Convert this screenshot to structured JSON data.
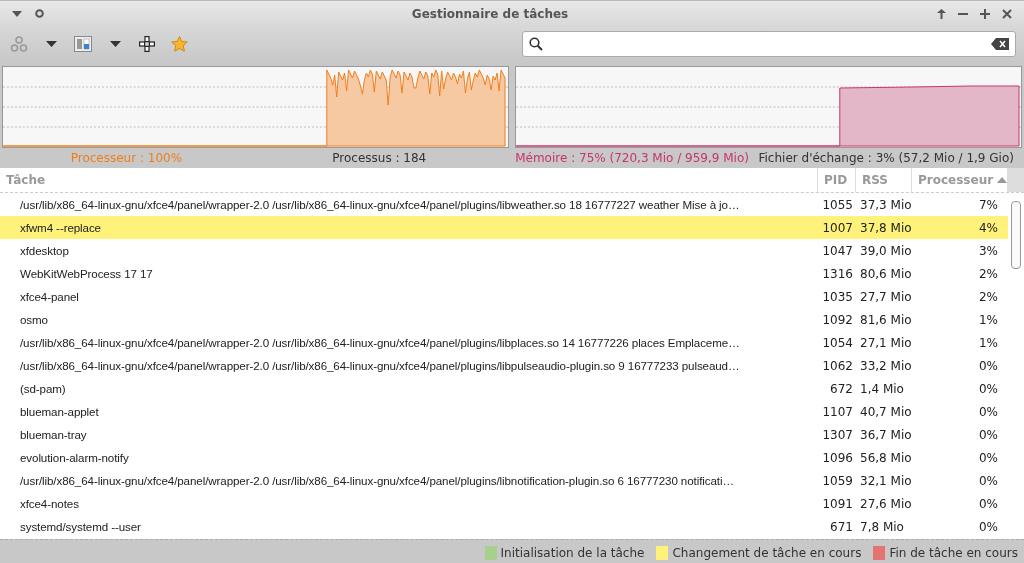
{
  "window": {
    "title": "Gestionnaire de tâches"
  },
  "stats": [
    {
      "kind": "cpu",
      "text": "Processeur : 100%"
    },
    {
      "kind": "plain",
      "text": "Processus : 184"
    },
    {
      "kind": "memory",
      "text": "Mémoire : 75% (720,3 Mio / 959,9 Mio)"
    },
    {
      "kind": "plain",
      "text": "Fichier d'échange : 3% (57,2 Mio / 1,9 Gio)"
    }
  ],
  "table": {
    "columns": [
      {
        "label": "Tâche",
        "sorted": false
      },
      {
        "label": "PID",
        "sorted": false
      },
      {
        "label": "RSS",
        "sorted": false
      },
      {
        "label": "Processeur",
        "sorted": true
      }
    ],
    "rows": [
      {
        "task": "/usr/lib/x86_64-linux-gnu/xfce4/panel/wrapper-2.0 /usr/lib/x86_64-linux-gnu/xfce4/panel/plugins/libweather.so 18 16777227 weather Mise à jo…",
        "pid": "1055",
        "rss": "37,3 Mio",
        "cpu": "7%",
        "changing": false
      },
      {
        "task": "xfwm4 --replace",
        "pid": "1007",
        "rss": "37,8 Mio",
        "cpu": "4%",
        "changing": true
      },
      {
        "task": "xfdesktop",
        "pid": "1047",
        "rss": "39,0 Mio",
        "cpu": "3%",
        "changing": false
      },
      {
        "task": "WebKitWebProcess 17 17",
        "pid": "1316",
        "rss": "80,6 Mio",
        "cpu": "2%",
        "changing": false
      },
      {
        "task": "xfce4-panel",
        "pid": "1035",
        "rss": "27,7 Mio",
        "cpu": "2%",
        "changing": false
      },
      {
        "task": "osmo",
        "pid": "1092",
        "rss": "81,6 Mio",
        "cpu": "1%",
        "changing": false
      },
      {
        "task": "/usr/lib/x86_64-linux-gnu/xfce4/panel/wrapper-2.0 /usr/lib/x86_64-linux-gnu/xfce4/panel/plugins/libplaces.so 14 16777226 places Emplaceme…",
        "pid": "1054",
        "rss": "27,1 Mio",
        "cpu": "1%",
        "changing": false
      },
      {
        "task": "/usr/lib/x86_64-linux-gnu/xfce4/panel/wrapper-2.0 /usr/lib/x86_64-linux-gnu/xfce4/panel/plugins/libpulseaudio-plugin.so 9 16777233 pulseaud…",
        "pid": "1062",
        "rss": "33,2 Mio",
        "cpu": "0%",
        "changing": false
      },
      {
        "task": "(sd-pam)",
        "pid": "672",
        "rss": "1,4 Mio",
        "cpu": "0%",
        "changing": false
      },
      {
        "task": "blueman-applet",
        "pid": "1107",
        "rss": "40,7 Mio",
        "cpu": "0%",
        "changing": false
      },
      {
        "task": "blueman-tray",
        "pid": "1307",
        "rss": "36,7 Mio",
        "cpu": "0%",
        "changing": false
      },
      {
        "task": "evolution-alarm-notify",
        "pid": "1096",
        "rss": "56,8 Mio",
        "cpu": "0%",
        "changing": false
      },
      {
        "task": "/usr/lib/x86_64-linux-gnu/xfce4/panel/wrapper-2.0 /usr/lib/x86_64-linux-gnu/xfce4/panel/plugins/libnotification-plugin.so 6 16777230 notificati…",
        "pid": "1059",
        "rss": "32,1 Mio",
        "cpu": "0%",
        "changing": false
      },
      {
        "task": "xfce4-notes",
        "pid": "1091",
        "rss": "27,6 Mio",
        "cpu": "0%",
        "changing": false
      },
      {
        "task": "systemd/systemd --user",
        "pid": "671",
        "rss": "7,8 Mio",
        "cpu": "0%",
        "changing": false
      }
    ]
  },
  "legend": [
    {
      "label": "Initialisation de la tâche",
      "color": "#a8d08d"
    },
    {
      "label": "Changement de tâche en cours",
      "color": "#fff27a"
    },
    {
      "label": "Fin de tâche en cours",
      "color": "#e57373"
    }
  ]
}
